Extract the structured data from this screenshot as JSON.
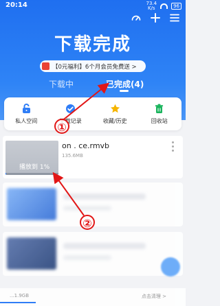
{
  "status_bar": {
    "time": "20:14",
    "speed_value": "73.4",
    "speed_unit": "K/s",
    "battery": "96"
  },
  "header": {
    "title": "下载完成",
    "promo": "【0元福利】6个月会员免费送 >",
    "actions": [
      {
        "icon": "speedometer-icon"
      },
      {
        "icon": "plus-icon"
      },
      {
        "icon": "menu-icon"
      }
    ]
  },
  "tabs": [
    {
      "label": "下载中"
    },
    {
      "label": "已完成(4)"
    }
  ],
  "quick_actions": [
    {
      "label": "私人空间",
      "icon": "lock-icon",
      "color": "#2f7df6"
    },
    {
      "label": "下载记录",
      "icon": "check-badge-icon",
      "color": "#2f7df6"
    },
    {
      "label": "收藏/历史",
      "icon": "star-icon",
      "color": "#f6b500"
    },
    {
      "label": "回收站",
      "icon": "trash-icon",
      "color": "#19b45c"
    }
  ],
  "file": {
    "name": "on . ce.rmvb",
    "size": "135.6MB",
    "progress_label": "播放到 1%",
    "progress": 0.01
  },
  "bottom": {
    "left": "...1.9GB",
    "right": "点击清理 >"
  },
  "annotations": [
    {
      "label": "①"
    },
    {
      "label": "②"
    }
  ],
  "colors": {
    "accent": "#2f7df6",
    "annotation_red": "#e21616"
  }
}
